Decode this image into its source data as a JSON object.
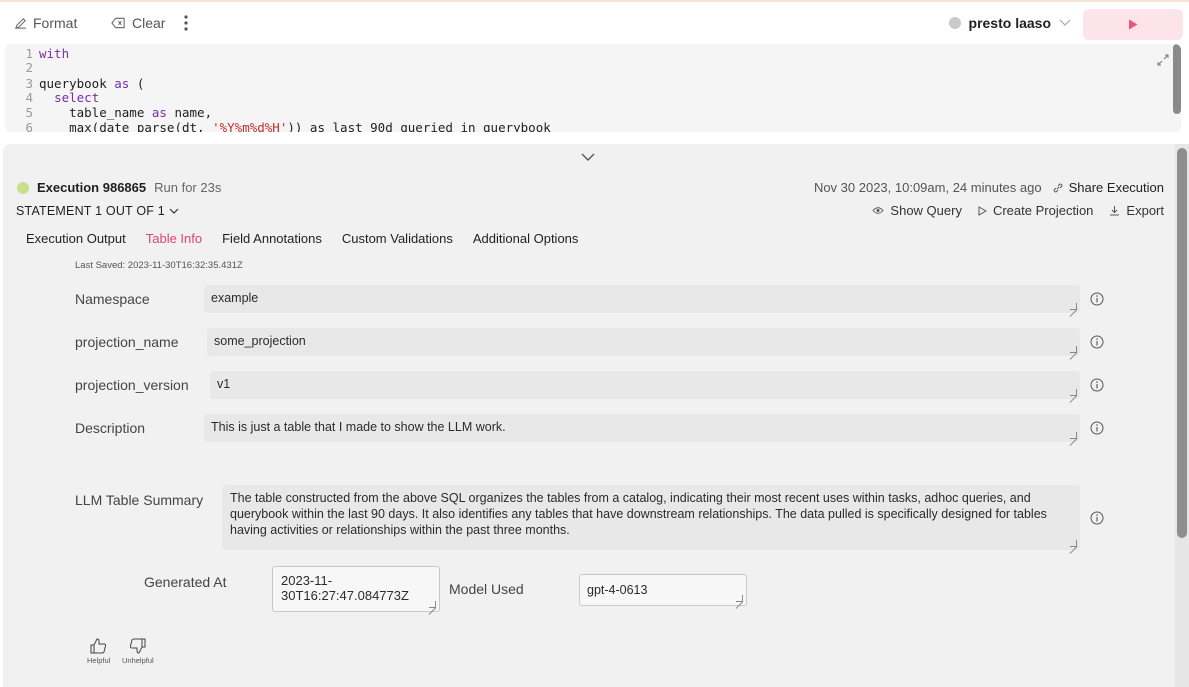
{
  "toolbar": {
    "format_label": "Format",
    "clear_label": "Clear",
    "engine_name": "presto laaso"
  },
  "editor": {
    "lines": [
      {
        "num": "1",
        "parts": [
          {
            "t": "kw",
            "v": "with"
          }
        ]
      },
      {
        "num": "2",
        "parts": []
      },
      {
        "num": "3",
        "parts": [
          {
            "t": "code",
            "v": "querybook "
          },
          {
            "t": "kw",
            "v": "as"
          },
          {
            "t": "code",
            "v": " ("
          }
        ]
      },
      {
        "num": "4",
        "parts": [
          {
            "t": "code",
            "v": "  "
          },
          {
            "t": "kw",
            "v": "select"
          }
        ]
      },
      {
        "num": "5",
        "parts": [
          {
            "t": "code",
            "v": "    table_name "
          },
          {
            "t": "kw",
            "v": "as"
          },
          {
            "t": "code",
            "v": " name,"
          }
        ]
      },
      {
        "num": "6",
        "parts": [
          {
            "t": "code",
            "v": "    max(date_parse(dt, "
          },
          {
            "t": "str",
            "v": "'%Y%m%d%H'"
          },
          {
            "t": "code",
            "v": ")) as last_90d_queried_in_querybook"
          }
        ]
      }
    ]
  },
  "execution": {
    "title": "Execution 986865",
    "run_for": "Run for 23s",
    "timestamp": "Nov 30 2023, 10:09am, 24 minutes ago",
    "share_label": "Share Execution",
    "statement_label": "STATEMENT 1 OUT OF 1",
    "status_color": "#c9df8a"
  },
  "actions": {
    "show_query": "Show Query",
    "create_projection": "Create Projection",
    "export": "Export"
  },
  "tabs": [
    {
      "label": "Execution Output",
      "active": false
    },
    {
      "label": "Table Info",
      "active": true
    },
    {
      "label": "Field Annotations",
      "active": false
    },
    {
      "label": "Custom Validations",
      "active": false
    },
    {
      "label": "Additional Options",
      "active": false
    }
  ],
  "table_info": {
    "last_saved": "Last Saved: 2023-11-30T16:32:35.431Z",
    "namespace": {
      "label": "Namespace",
      "value": "example"
    },
    "projection_name": {
      "label": "projection_name",
      "value": "some_projection"
    },
    "projection_version": {
      "label": "projection_version",
      "value": "v1"
    },
    "description": {
      "label": "Description",
      "value": "This is just a table that I made to show the LLM work."
    },
    "summary": {
      "label": "LLM Table Summary",
      "value": "The table constructed from the above SQL organizes the tables from a catalog, indicating their most recent uses within tasks, adhoc queries, and querybook within the last 90 days. It also identifies any tables that have downstream relationships. The data pulled is specifically designed for tables having activities or relationships within the past three months."
    },
    "generated_at": {
      "label": "Generated At",
      "value": "2023-11-30T16:27:47.084773Z"
    },
    "model_used": {
      "label": "Model Used",
      "value": "gpt-4-0613"
    }
  },
  "feedback": {
    "helpful": "Helpful",
    "unhelpful": "Unhelpful"
  },
  "colors": {
    "accent": "#e0456e",
    "run_button": "#fde3ea",
    "run_icon": "#f0527e"
  }
}
